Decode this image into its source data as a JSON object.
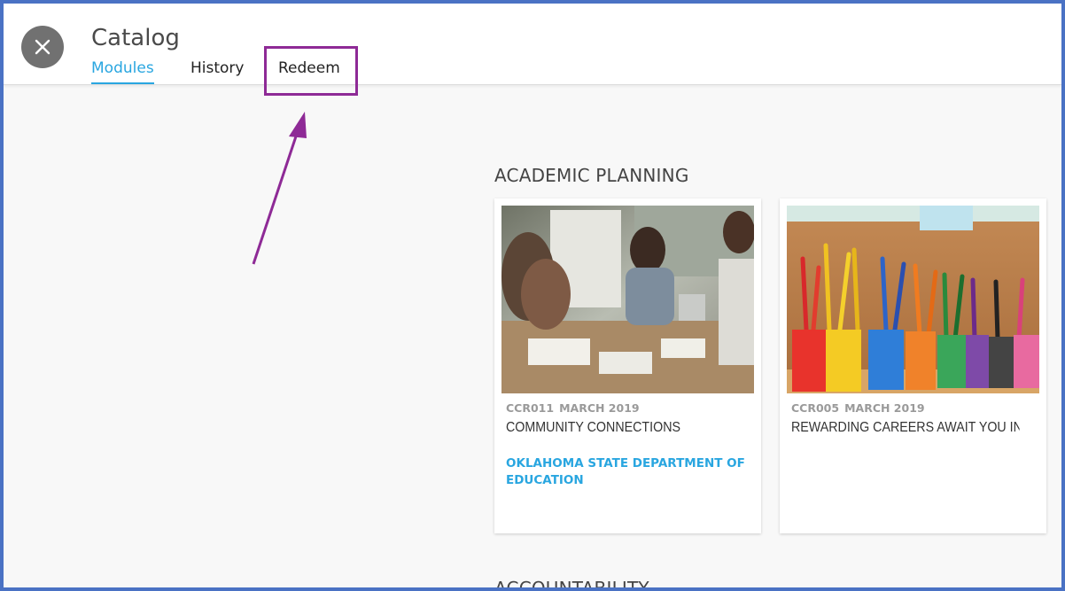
{
  "header": {
    "title": "Catalog",
    "tabs": [
      {
        "label": "Modules",
        "active": true
      },
      {
        "label": "History",
        "active": false
      },
      {
        "label": "Redeem",
        "active": false
      }
    ],
    "close_icon": "close-icon"
  },
  "sections": [
    {
      "title": "ACADEMIC PLANNING",
      "cards": [
        {
          "code": "CCR011",
          "date": "MARCH 2019",
          "title": "COMMUNITY CONNECTIONS",
          "org": "OKLAHOMA STATE DEPARTMENT OF EDUCATION",
          "image": "photo of people collaborating at a table"
        },
        {
          "code": "CCR005",
          "date": "MARCH 2019",
          "title": "REWARDING CAREERS AWAIT YOU IN THE...",
          "org": "",
          "image": "photo of colored pencils in colorful cups"
        }
      ]
    },
    {
      "title": "ACCOUNTABILITY",
      "cards": []
    }
  ],
  "colors": {
    "accent": "#29a6e0",
    "annotation": "#8e2a96",
    "frame_border": "#4a72c4",
    "close_button": "#717171"
  }
}
